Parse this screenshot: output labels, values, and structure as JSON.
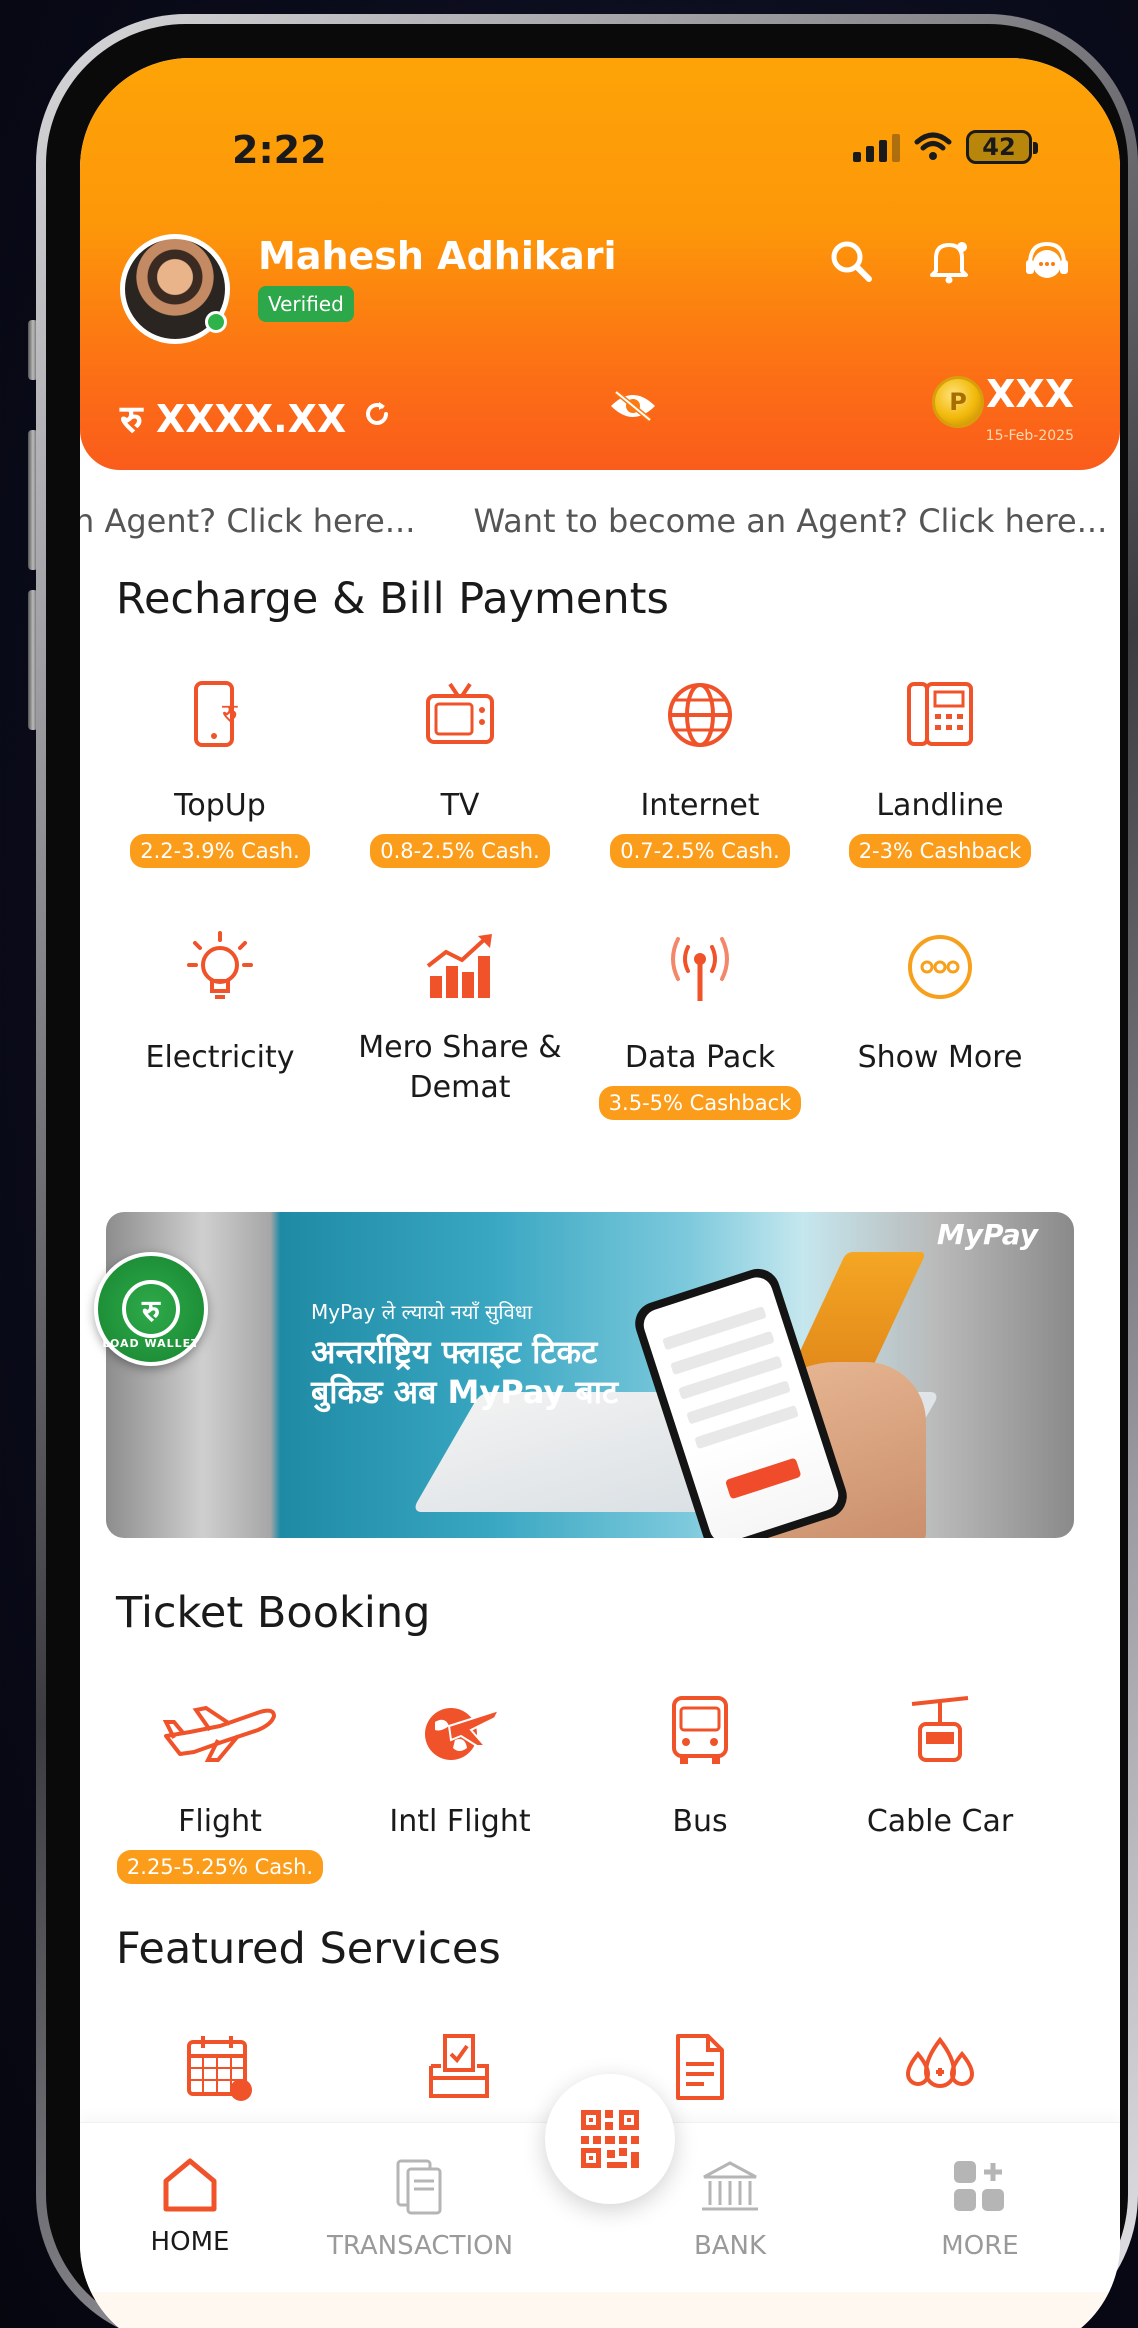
{
  "status_bar": {
    "time": "2:22",
    "battery": "42"
  },
  "header": {
    "user_name": "Mahesh Adhikari",
    "verified_label": "Verified",
    "balance": "रु XXXX.XX",
    "points": "XXX",
    "points_date": "15-Feb-2025",
    "coin_symbol": "P"
  },
  "ticker": {
    "items": [
      "n Agent? Click here...",
      "Want to become an Agent? Click here..."
    ]
  },
  "recharge": {
    "title": "Recharge & Bill Payments",
    "items": [
      {
        "label": "TopUp",
        "badge": "2.2-3.9% Cash.",
        "icon": "mobile-topup-icon"
      },
      {
        "label": "TV",
        "badge": "0.8-2.5% Cash.",
        "icon": "tv-icon"
      },
      {
        "label": "Internet",
        "badge": "0.7-2.5% Cash.",
        "icon": "globe-icon"
      },
      {
        "label": "Landline",
        "badge": "2-3% Cashback",
        "icon": "landline-phone-icon"
      },
      {
        "label": "Electricity",
        "badge": "",
        "icon": "bulb-icon"
      },
      {
        "label": "Mero Share & Demat",
        "badge": "",
        "icon": "bar-chart-icon"
      },
      {
        "label": "Data Pack",
        "badge": "3.5-5% Cashback",
        "icon": "antenna-icon"
      },
      {
        "label": "Show More",
        "badge": "",
        "icon": "more-dots-icon"
      }
    ]
  },
  "banner": {
    "subtitle": "MyPay ले ल्यायो नयाँ सुविधा",
    "line1": "अन्तर्राष्ट्रिय फ्लाइट टिकट",
    "line2": "बुकिङ अब MyPay बाट",
    "brand": "MyPay",
    "load_wallet_symbol": "रु",
    "load_wallet_text": "LOAD WALLET"
  },
  "ticket_booking": {
    "title": "Ticket Booking",
    "items": [
      {
        "label": "Flight",
        "badge": "2.25-5.25% Cash.",
        "icon": "airplane-icon"
      },
      {
        "label": "Intl Flight",
        "badge": "",
        "icon": "intl-flight-icon"
      },
      {
        "label": "Bus",
        "badge": "",
        "icon": "bus-icon"
      },
      {
        "label": "Cable Car",
        "badge": "",
        "icon": "cable-car-icon"
      }
    ]
  },
  "featured": {
    "title": "Featured Services",
    "icons": [
      "calendar-icon",
      "ballot-box-icon",
      "document-icon",
      "blood-donation-icon"
    ]
  },
  "bottom_nav": {
    "home": "HOME",
    "transaction": "TRANSACTION",
    "bank": "BANK",
    "more": "MORE"
  },
  "colors": {
    "accent": "#f0532a",
    "badge": "#fb9d1a",
    "header_top": "#fda307",
    "header_bottom": "#fa5c1b",
    "verified": "#2ca84a"
  }
}
